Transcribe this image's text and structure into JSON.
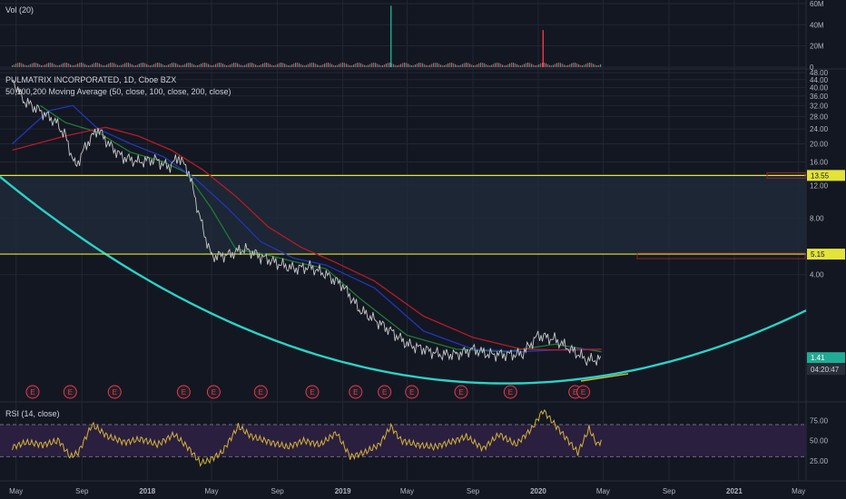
{
  "colors": {
    "background": "#131722",
    "grid": "#232733",
    "separator": "#2a2e39",
    "price": "#c8c8c8",
    "sma50": "#1e7a35",
    "sma100": "#2236b8",
    "sma200": "#b51b26",
    "fit_curve": "#2ad3c6",
    "level": "#e3e33a",
    "rsi_line": "#d4b13a",
    "rsi_band": "#2a1f3f",
    "vol_up": "#22ab94",
    "vol_down": "#f23645",
    "badge_bg": "#2a2e39"
  },
  "volume_panel": {
    "title": "Vol (20)",
    "ticks": [
      "60M",
      "40M",
      "20M",
      "0"
    ]
  },
  "price_panel": {
    "title": "PULMATRIX INCORPORATED, 1D, Cboe BZX",
    "ma_label": "50,100,200 Moving Average (50, close, 100, close, 200, close)",
    "ticks": [
      "48.00",
      "44.00",
      "40.00",
      "36.00",
      "32.00",
      "28.00",
      "24.00",
      "20.00",
      "16.00",
      "12.00",
      "8.00",
      "4.00"
    ],
    "badges": {
      "level_upper": "13.55",
      "level_lower": "5.15",
      "last_price": "1.41",
      "countdown": "04:20:47"
    },
    "earnings_marker": "E"
  },
  "rsi_panel": {
    "title": "RSI (14, close)",
    "ticks": [
      "75.00",
      "50.00",
      "25.00"
    ]
  },
  "x_axis": {
    "labels": [
      "May",
      "Sep",
      "2018",
      "May",
      "Sep",
      "2019",
      "May",
      "Sep",
      "2020",
      "May",
      "Sep",
      "2021",
      "May"
    ]
  },
  "chart_data": {
    "type": "line",
    "title": "PULMATRIX INCORPORATED, 1D, Cboe BZX",
    "yscale": "log",
    "ylim": [
      1.0,
      48.0
    ],
    "x_range": [
      "2017-04-01",
      "2021-05-15"
    ],
    "series": [
      {
        "name": "Price",
        "x": [
          "2017-04-24",
          "2017-05-15",
          "2017-06-15",
          "2017-07-15",
          "2017-08-01",
          "2017-08-20",
          "2017-09-10",
          "2017-10-01",
          "2017-10-20",
          "2017-11-15",
          "2017-12-15",
          "2018-01-15",
          "2018-02-10",
          "2018-03-01",
          "2018-03-20",
          "2018-04-01",
          "2018-04-15",
          "2018-05-01",
          "2018-06-01",
          "2018-07-01",
          "2018-08-01",
          "2018-09-01",
          "2018-10-01",
          "2018-11-01",
          "2018-12-01",
          "2019-01-01",
          "2019-02-01",
          "2019-03-01",
          "2019-04-01",
          "2019-05-01",
          "2019-06-01",
          "2019-07-01",
          "2019-08-01",
          "2019-09-01",
          "2019-10-01",
          "2019-11-01",
          "2019-12-01",
          "2020-01-01",
          "2020-02-01",
          "2020-03-01",
          "2020-04-01",
          "2020-04-28"
        ],
        "values": [
          44.0,
          34.0,
          30.0,
          26.0,
          22.0,
          15.0,
          20.0,
          24.0,
          20.0,
          17.0,
          16.0,
          16.5,
          15.0,
          17.0,
          14.0,
          10.0,
          7.0,
          5.0,
          5.1,
          5.5,
          5.0,
          4.6,
          4.3,
          4.4,
          4.0,
          3.5,
          2.6,
          2.3,
          2.0,
          1.7,
          1.6,
          1.5,
          1.5,
          1.6,
          1.5,
          1.5,
          1.5,
          1.9,
          1.8,
          1.6,
          1.4,
          1.41
        ]
      },
      {
        "name": "MA50",
        "x": [
          "2017-06-15",
          "2017-08-01",
          "2017-10-01",
          "2017-12-01",
          "2018-02-01",
          "2018-03-15",
          "2018-05-01",
          "2018-06-15",
          "2018-08-01",
          "2018-10-01",
          "2018-12-01",
          "2019-02-01",
          "2019-05-01",
          "2019-08-01",
          "2019-11-01",
          "2020-02-01",
          "2020-04-28"
        ],
        "values": [
          32.0,
          26.0,
          23.0,
          18.0,
          16.0,
          14.0,
          9.0,
          5.5,
          5.2,
          4.7,
          4.3,
          3.0,
          1.9,
          1.6,
          1.55,
          1.7,
          1.55
        ]
      },
      {
        "name": "MA100",
        "x": [
          "2017-04-24",
          "2017-07-01",
          "2017-08-15",
          "2017-10-01",
          "2017-12-01",
          "2018-02-01",
          "2018-04-01",
          "2018-06-01",
          "2018-08-01",
          "2018-10-01",
          "2018-12-01",
          "2019-03-01",
          "2019-06-01",
          "2019-09-01",
          "2019-12-01",
          "2020-03-01",
          "2020-04-28"
        ],
        "values": [
          20.0,
          30.0,
          32.0,
          24.0,
          20.0,
          17.0,
          13.0,
          9.0,
          6.0,
          4.9,
          4.5,
          3.4,
          2.0,
          1.6,
          1.55,
          1.6,
          1.6
        ]
      },
      {
        "name": "MA200",
        "x": [
          "2017-04-24",
          "2017-08-01",
          "2017-10-15",
          "2017-12-15",
          "2018-02-15",
          "2018-04-15",
          "2018-06-15",
          "2018-08-15",
          "2018-10-15",
          "2018-12-15",
          "2019-03-01",
          "2019-06-01",
          "2019-09-01",
          "2019-12-01",
          "2020-03-01",
          "2020-04-28"
        ],
        "values": [
          18.5,
          22.0,
          24.5,
          22.0,
          18.5,
          14.5,
          10.5,
          7.2,
          5.6,
          4.7,
          3.7,
          2.4,
          1.85,
          1.6,
          1.58,
          1.6
        ]
      }
    ],
    "horizontal_levels": [
      13.55,
      5.15
    ],
    "volume": {
      "ylim": [
        0,
        60000000
      ],
      "spikes": [
        {
          "x": "2019-04-01",
          "value": 58000000
        },
        {
          "x": "2020-01-10",
          "value": 35000000
        }
      ]
    },
    "rsi": {
      "ylim": [
        0,
        100
      ],
      "bands": [
        30,
        70
      ],
      "x": [
        "2017-04-24",
        "2017-05-20",
        "2017-06-20",
        "2017-07-20",
        "2017-08-10",
        "2017-08-25",
        "2017-09-20",
        "2017-10-20",
        "2017-11-20",
        "2017-12-20",
        "2018-01-20",
        "2018-02-20",
        "2018-03-20",
        "2018-04-10",
        "2018-04-25",
        "2018-05-20",
        "2018-06-20",
        "2018-07-15",
        "2018-08-20",
        "2018-09-20",
        "2018-10-20",
        "2018-11-20",
        "2018-12-20",
        "2019-01-15",
        "2019-02-10",
        "2019-03-10",
        "2019-04-01",
        "2019-04-20",
        "2019-05-20",
        "2019-06-20",
        "2019-07-20",
        "2019-08-20",
        "2019-09-20",
        "2019-10-20",
        "2019-11-20",
        "2019-12-20",
        "2020-01-10",
        "2020-02-01",
        "2020-02-20",
        "2020-03-15",
        "2020-04-05",
        "2020-04-20",
        "2020-04-28"
      ],
      "values": [
        42,
        48,
        45,
        50,
        30,
        35,
        70,
        55,
        48,
        52,
        45,
        58,
        40,
        22,
        25,
        35,
        68,
        55,
        48,
        42,
        50,
        45,
        60,
        30,
        35,
        45,
        68,
        50,
        45,
        42,
        48,
        55,
        40,
        58,
        45,
        65,
        88,
        70,
        55,
        35,
        65,
        45,
        50
      ]
    },
    "earnings_dates": [
      "2017-06-01",
      "2017-08-10",
      "2017-11-01",
      "2018-03-10",
      "2018-05-05",
      "2018-08-01",
      "2018-11-05",
      "2019-01-25",
      "2019-03-20",
      "2019-05-10",
      "2019-08-10",
      "2019-11-10",
      "2020-03-10",
      "2020-03-25"
    ]
  }
}
